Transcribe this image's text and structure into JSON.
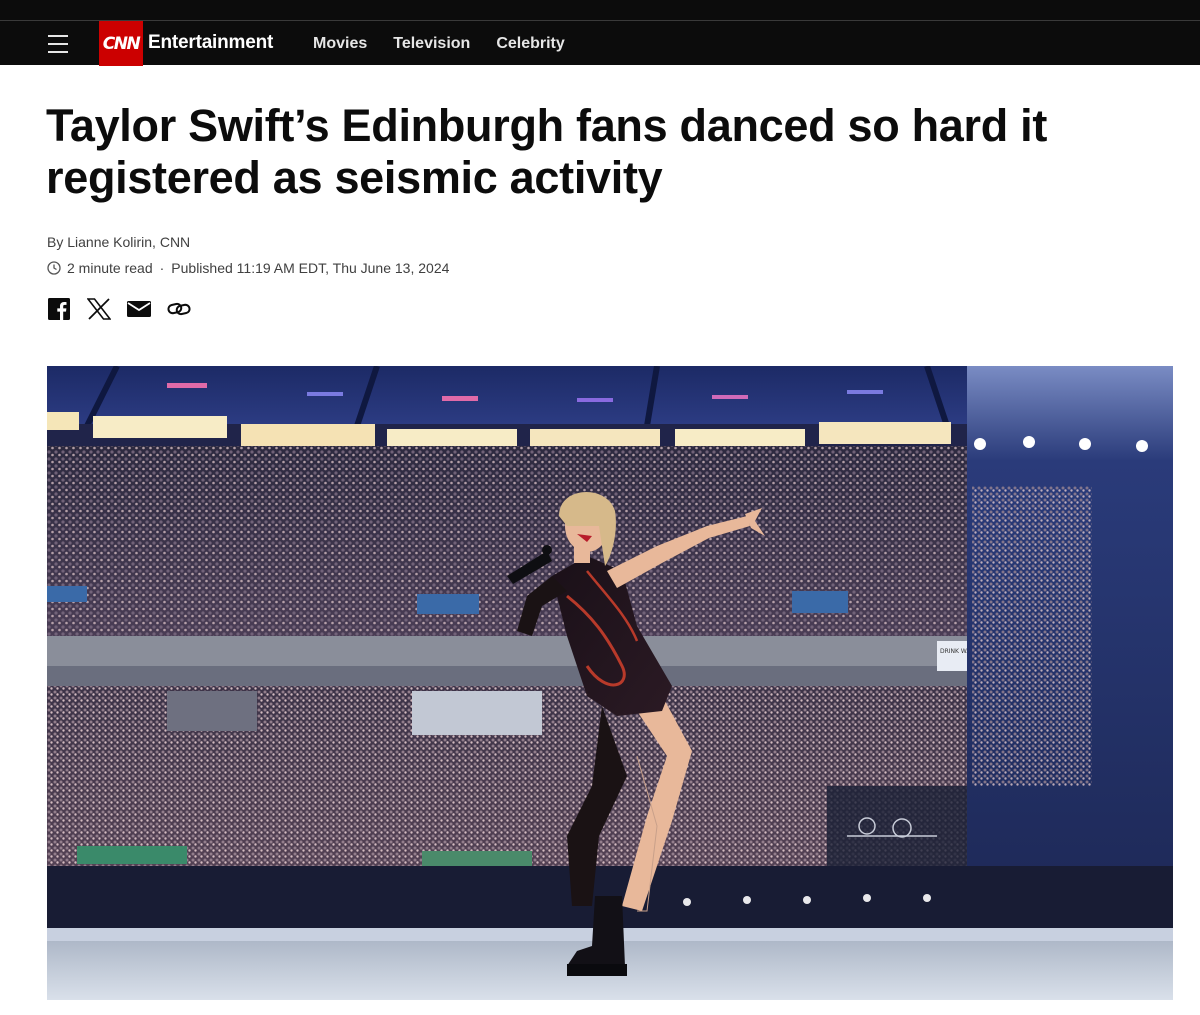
{
  "site": {
    "logo_text": "CNN",
    "section": "Entertainment",
    "brand_color": "#cc0000",
    "nav": [
      "Movies",
      "Television",
      "Celebrity"
    ]
  },
  "article": {
    "headline": "Taylor Swift’s Edinburgh fans danced so hard it registered as seismic activity",
    "byline": "By Lianne Kolirin, CNN",
    "read_time": "2 minute read",
    "published": "Published 11:19 AM EDT, Thu June 13, 2024"
  },
  "share_icons": [
    "facebook-icon",
    "x-icon",
    "email-icon",
    "link-icon"
  ],
  "photo": {
    "banner_text": "DRINK WATER"
  }
}
